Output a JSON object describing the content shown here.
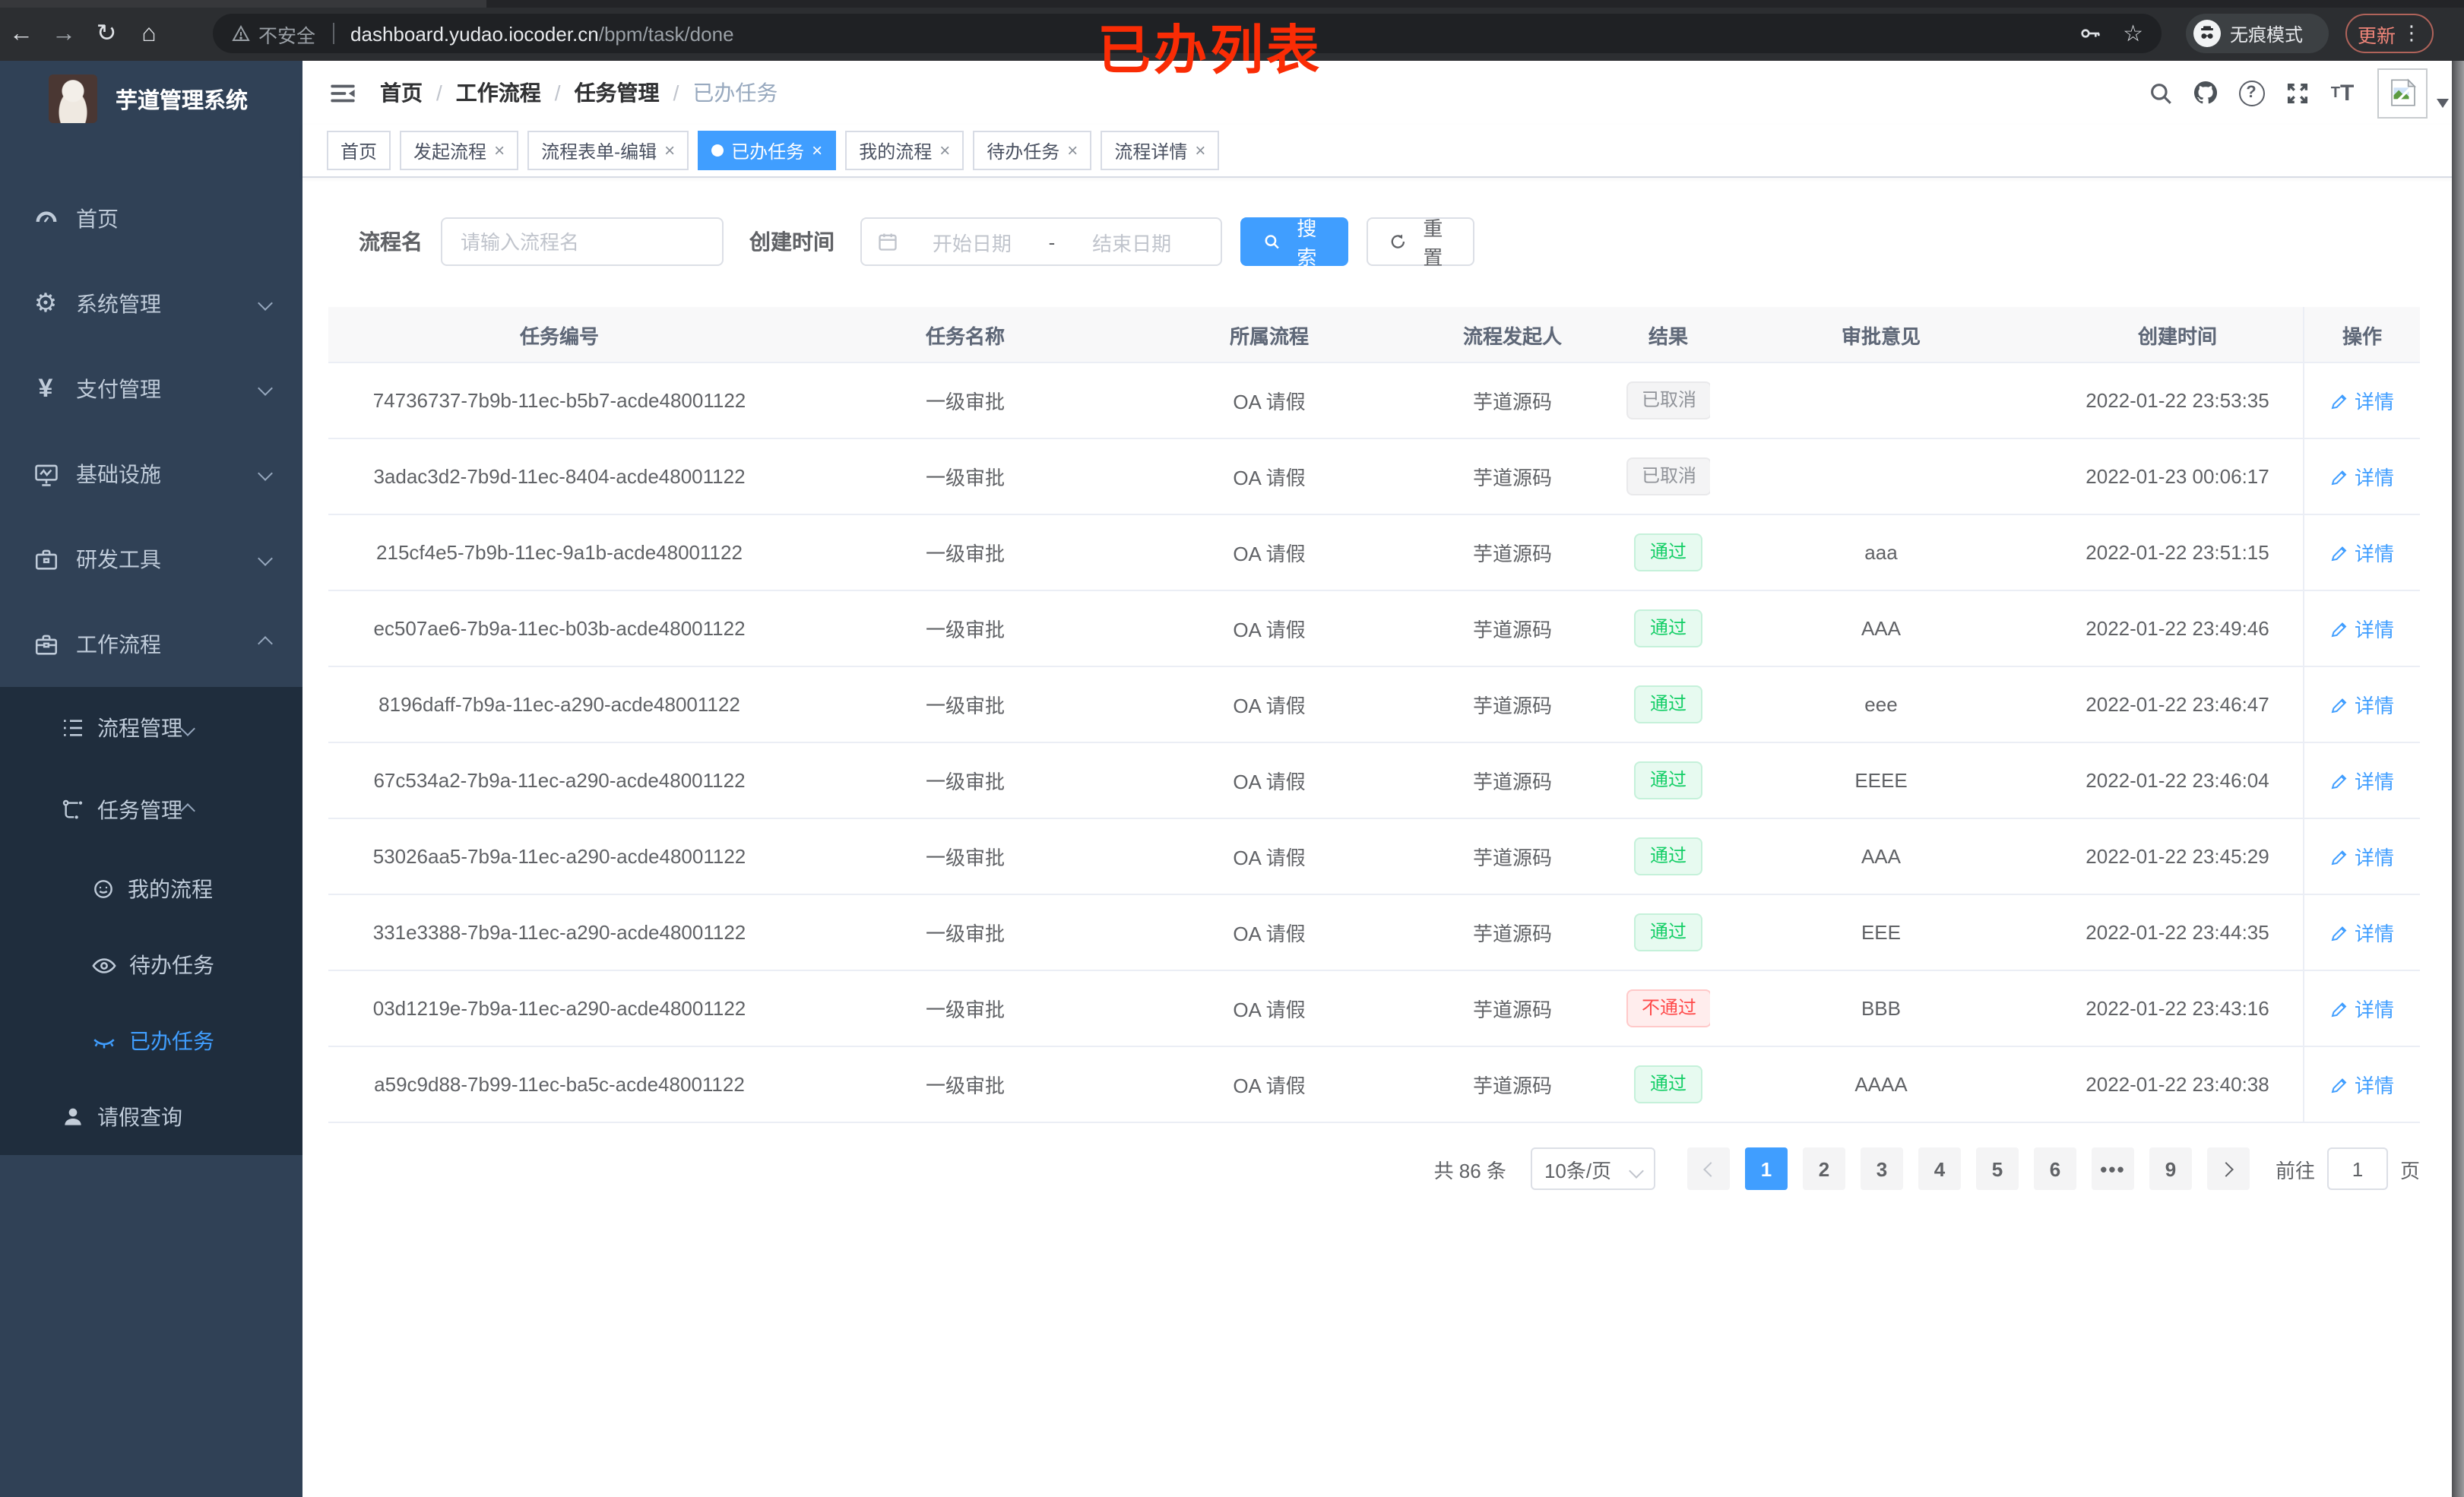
{
  "browser": {
    "security_label": "不安全",
    "url_host": "dashboard.yudao.iocoder.cn",
    "url_path": "/bpm/task/done",
    "incognito_label": "无痕模式",
    "update_label": "更新"
  },
  "annotation": {
    "text": "已办列表",
    "color": "#fa2c05"
  },
  "sidebar": {
    "title": "芋道管理系统",
    "items": [
      {
        "label": "首页",
        "icon": "dashboard-icon"
      },
      {
        "label": "系统管理",
        "icon": "gear-icon"
      },
      {
        "label": "支付管理",
        "icon": "yen-icon"
      },
      {
        "label": "基础设施",
        "icon": "monitor-icon"
      },
      {
        "label": "研发工具",
        "icon": "toolbox-icon"
      },
      {
        "label": "工作流程",
        "icon": "briefcase-icon",
        "expanded": true
      }
    ],
    "workflow": {
      "process_mgmt": "流程管理",
      "task_mgmt": "任务管理",
      "my_process": "我的流程",
      "todo_task": "待办任务",
      "done_task": "已办任务",
      "leave_query": "请假查询",
      "active": "已办任务"
    }
  },
  "breadcrumb": {
    "items": [
      "首页",
      "工作流程",
      "任务管理",
      "已办任务"
    ]
  },
  "tabs": {
    "items": [
      {
        "label": "首页",
        "closable": false
      },
      {
        "label": "发起流程",
        "closable": true
      },
      {
        "label": "流程表单-编辑",
        "closable": true
      },
      {
        "label": "已办任务",
        "closable": true,
        "active": true
      },
      {
        "label": "我的流程",
        "closable": true
      },
      {
        "label": "待办任务",
        "closable": true
      },
      {
        "label": "流程详情",
        "closable": true
      }
    ],
    "close_glyph": "×"
  },
  "filters": {
    "name_label": "流程名",
    "name_placeholder": "请输入流程名",
    "date_label": "创建时间",
    "start_placeholder": "开始日期",
    "range_separator": "-",
    "end_placeholder": "结束日期",
    "search_label": "搜索",
    "reset_label": "重置"
  },
  "table": {
    "headers": [
      "任务编号",
      "任务名称",
      "所属流程",
      "流程发起人",
      "结果",
      "审批意见",
      "创建时间",
      "操作"
    ],
    "action_label": "详情",
    "rows": [
      {
        "id": "74736737-7b9b-11ec-b5b7-acde48001122",
        "name": "一级审批",
        "process": "OA 请假",
        "starter": "芋道源码",
        "result": "已取消",
        "result_type": "info",
        "opinion": "",
        "created": "2022-01-22 23:53:35"
      },
      {
        "id": "3adac3d2-7b9d-11ec-8404-acde48001122",
        "name": "一级审批",
        "process": "OA 请假",
        "starter": "芋道源码",
        "result": "已取消",
        "result_type": "info",
        "opinion": "",
        "created": "2022-01-23 00:06:17"
      },
      {
        "id": "215cf4e5-7b9b-11ec-9a1b-acde48001122",
        "name": "一级审批",
        "process": "OA 请假",
        "starter": "芋道源码",
        "result": "通过",
        "result_type": "success",
        "opinion": "aaa",
        "created": "2022-01-22 23:51:15"
      },
      {
        "id": "ec507ae6-7b9a-11ec-b03b-acde48001122",
        "name": "一级审批",
        "process": "OA 请假",
        "starter": "芋道源码",
        "result": "通过",
        "result_type": "success",
        "opinion": "AAA",
        "created": "2022-01-22 23:49:46"
      },
      {
        "id": "8196daff-7b9a-11ec-a290-acde48001122",
        "name": "一级审批",
        "process": "OA 请假",
        "starter": "芋道源码",
        "result": "通过",
        "result_type": "success",
        "opinion": "eee",
        "created": "2022-01-22 23:46:47"
      },
      {
        "id": "67c534a2-7b9a-11ec-a290-acde48001122",
        "name": "一级审批",
        "process": "OA 请假",
        "starter": "芋道源码",
        "result": "通过",
        "result_type": "success",
        "opinion": "EEEE",
        "created": "2022-01-22 23:46:04"
      },
      {
        "id": "53026aa5-7b9a-11ec-a290-acde48001122",
        "name": "一级审批",
        "process": "OA 请假",
        "starter": "芋道源码",
        "result": "通过",
        "result_type": "success",
        "opinion": "AAA",
        "created": "2022-01-22 23:45:29"
      },
      {
        "id": "331e3388-7b9a-11ec-a290-acde48001122",
        "name": "一级审批",
        "process": "OA 请假",
        "starter": "芋道源码",
        "result": "通过",
        "result_type": "success",
        "opinion": "EEE",
        "created": "2022-01-22 23:44:35"
      },
      {
        "id": "03d1219e-7b9a-11ec-a290-acde48001122",
        "name": "一级审批",
        "process": "OA 请假",
        "starter": "芋道源码",
        "result": "不通过",
        "result_type": "danger",
        "opinion": "BBB",
        "created": "2022-01-22 23:43:16"
      },
      {
        "id": "a59c9d88-7b99-11ec-ba5c-acde48001122",
        "name": "一级审批",
        "process": "OA 请假",
        "starter": "芋道源码",
        "result": "通过",
        "result_type": "success",
        "opinion": "AAAA",
        "created": "2022-01-22 23:40:38"
      }
    ]
  },
  "pagination": {
    "total": "共 86 条",
    "page_size": "10条/页",
    "pages": [
      "1",
      "2",
      "3",
      "4",
      "5",
      "6"
    ],
    "ellipsis": "•••",
    "last_page": "9",
    "active_page": "1",
    "goto_label": "前往",
    "goto_value": "1",
    "unit_label": "页"
  }
}
